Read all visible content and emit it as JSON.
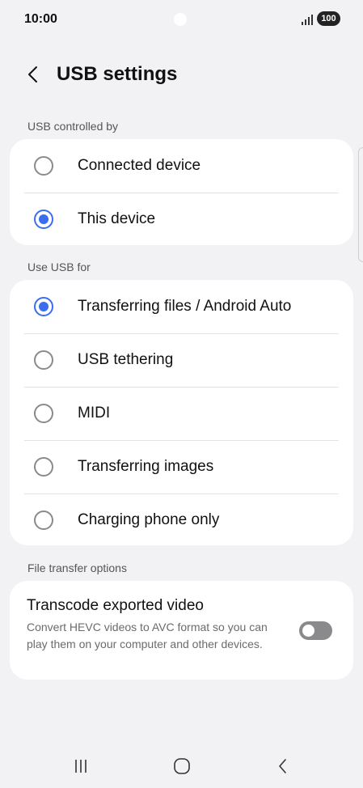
{
  "status_bar": {
    "time": "10:00",
    "battery": "100",
    "signal_icon": "signal-bars-icon"
  },
  "header": {
    "back_icon": "chevron-left-icon",
    "title": "USB settings"
  },
  "usb_controlled_by": {
    "heading": "USB controlled by",
    "options": [
      {
        "label": "Connected device",
        "selected": false
      },
      {
        "label": "This device",
        "selected": true
      }
    ]
  },
  "use_usb_for": {
    "heading": "Use USB for",
    "options": [
      {
        "label": "Transferring files / Android Auto",
        "selected": true
      },
      {
        "label": "USB tethering",
        "selected": false
      },
      {
        "label": "MIDI",
        "selected": false
      },
      {
        "label": "Transferring images",
        "selected": false
      },
      {
        "label": "Charging phone only",
        "selected": false
      }
    ]
  },
  "file_transfer_options": {
    "heading": "File transfer options",
    "title": "Transcode exported video",
    "description": "Convert HEVC videos to AVC format so you can play them on your computer and other devices.",
    "toggle_on": false
  },
  "nav_bar": {
    "recents_icon": "recents-icon",
    "home_icon": "home-icon",
    "back_icon": "back-icon"
  },
  "colors": {
    "accent": "#3a6df0",
    "background": "#f2f2f4",
    "card": "#ffffff"
  }
}
